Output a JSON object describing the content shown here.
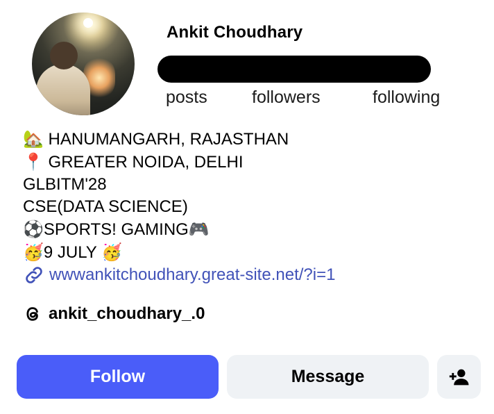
{
  "profile": {
    "name": "Ankit Choudhary",
    "stats": {
      "posts_label": "posts",
      "followers_label": "followers",
      "following_label": "following"
    }
  },
  "bio": {
    "lines": [
      {
        "emoji": "🏡",
        "text": " HANUMANGARH, RAJASTHAN"
      },
      {
        "emoji": "📍",
        "text": " GREATER NOIDA, DELHI"
      },
      {
        "emoji": "",
        "text": "GLBITM'28"
      },
      {
        "emoji": "",
        "text": "CSE(DATA SCIENCE)"
      },
      {
        "emoji": "⚽",
        "text": "SPORTS! GAMING",
        "emoji_after": "🎮"
      },
      {
        "emoji": "🥳",
        "text": "9 JULY ",
        "emoji_after": "🥳"
      }
    ],
    "link": "wwwankitchoudhary.great-site.net/?i=1",
    "threads_handle": "ankit_choudhary_.0"
  },
  "actions": {
    "follow_label": "Follow",
    "message_label": "Message"
  },
  "icons": {
    "link": "link-icon",
    "threads": "threads-icon",
    "add_person": "add-person-icon"
  },
  "colors": {
    "accent": "#4a5df9",
    "link": "#4152b8",
    "secondary_button": "#eff2f5"
  }
}
